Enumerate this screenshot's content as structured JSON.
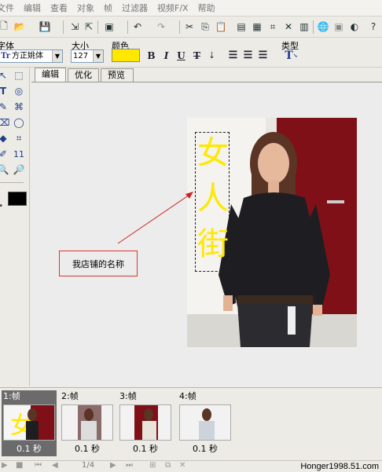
{
  "menu": [
    "文件",
    "编辑",
    "查看",
    "对象",
    "帧",
    "过滤器",
    "视频F/X",
    "帮助"
  ],
  "format": {
    "font_label": "字体",
    "font_value": "方正姚体",
    "size_label": "大小",
    "size_value": "127",
    "color_label": "颜色",
    "color_value": "#ffe800",
    "type_label": "类型"
  },
  "tabs": [
    "编辑",
    "优化",
    "预览"
  ],
  "canvas": {
    "overlay_text": "女人街",
    "callout_text": "我店铺的名称"
  },
  "frames": [
    {
      "label": "1:帧",
      "duration": "0.1 秒"
    },
    {
      "label": "2:帧",
      "duration": "0.1 秒"
    },
    {
      "label": "3:帧",
      "duration": "0.1 秒"
    },
    {
      "label": "4:帧",
      "duration": "0.1 秒"
    }
  ],
  "status": {
    "page": "1/4",
    "watermark": "Honger1998.51.com"
  },
  "colors": {
    "accent_yellow": "#ffe800",
    "backdrop_red": "#7f1018"
  }
}
